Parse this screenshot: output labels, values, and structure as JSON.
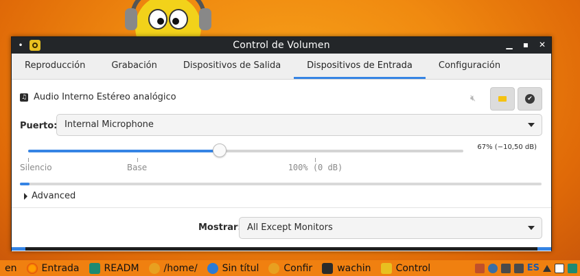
{
  "colors": {
    "accent": "#3584e4",
    "titlebar": "#232629",
    "taskbar": "#f08010"
  },
  "window": {
    "title": "Control de Volumen"
  },
  "tabs": [
    {
      "label": "Reproducción"
    },
    {
      "label": "Grabación"
    },
    {
      "label": "Dispositivos de Salida"
    },
    {
      "label": "Dispositivos de Entrada",
      "active": true
    },
    {
      "label": "Configuración"
    }
  ],
  "device": {
    "name": "Audio Interno Estéreo analógico",
    "port_label": "Puerto:",
    "port_value": "Internal Microphone",
    "volume_text": "67% (−10,50 dB)",
    "volume_fraction": 0.44,
    "level_fraction": 0.018,
    "ticks": [
      {
        "label": "Silencio",
        "value": 0.0
      },
      {
        "label": "Base",
        "value": 0.25
      },
      {
        "label": "100% (0 dB)",
        "value": 0.66
      }
    ],
    "advanced_label": "Advanced"
  },
  "footer": {
    "show_label": "Mostrar:",
    "show_value": "All Except Monitors"
  },
  "taskbar": {
    "items": [
      {
        "label": "en",
        "icon": "none"
      },
      {
        "label": "Entrada",
        "icon": "firefox-icon"
      },
      {
        "label": "READM",
        "icon": "editor-icon"
      },
      {
        "label": "/home/",
        "icon": "files-icon"
      },
      {
        "label": "Sin títul",
        "icon": "globe-icon"
      },
      {
        "label": "Confir",
        "icon": "settings-icon"
      },
      {
        "label": "wachin",
        "icon": "terminal-icon"
      },
      {
        "label": "Control",
        "icon": "volume-app-icon"
      }
    ],
    "tray": {
      "lang": "ES"
    }
  }
}
